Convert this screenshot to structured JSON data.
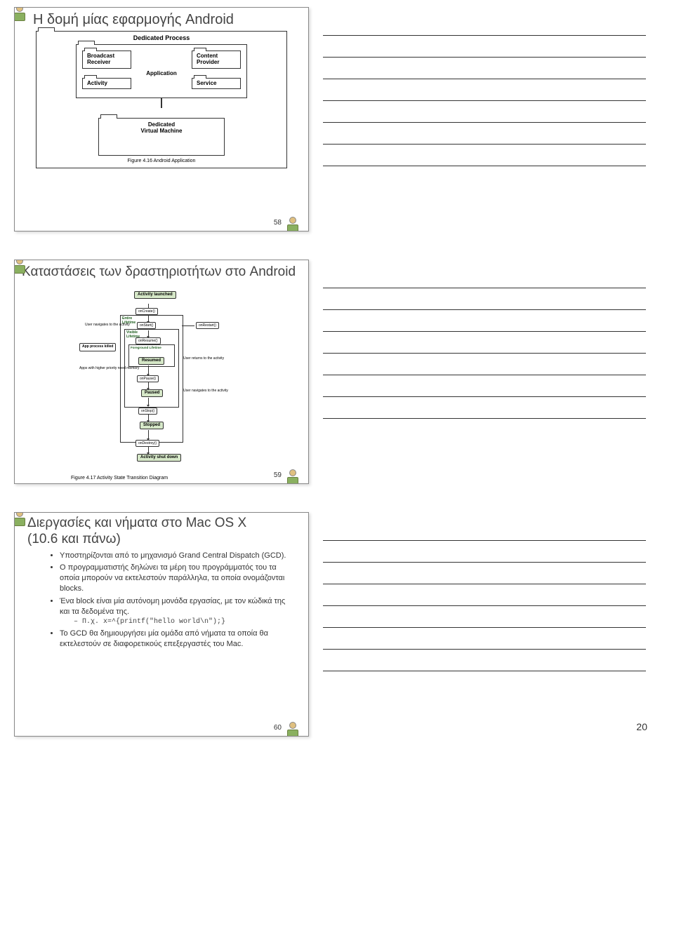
{
  "page_number": "20",
  "slide1": {
    "number": "58",
    "title": "Η δομή μίας εφαρμογής Android",
    "process_label": "Dedicated Process",
    "app_label": "Application",
    "boxes": {
      "broadcast": "Broadcast\nReceiver",
      "content": "Content\nProvider",
      "activity": "Activity",
      "service": "Service"
    },
    "vm_label": "Dedicated\nVirtual Machine",
    "caption": "Figure 4.16 Android Application"
  },
  "slide2": {
    "number": "59",
    "title": "Καταστάσεις των δραστηριοτήτων στο Android",
    "states": {
      "launched": "Activity\nlaunched",
      "resumed": "Resumed",
      "paused": "Paused",
      "stopped": "Stopped",
      "shutdown": "Activity\nshut down"
    },
    "calls": {
      "oncreate": "onCreate()",
      "onstart": "onStart()",
      "onresume": "onResume()",
      "onpause": "onPause()",
      "onstop": "onStop()",
      "ondestroy": "onDestroy()",
      "onrestart": "onRestart()"
    },
    "frames": {
      "entire": "Entire\nLifetime",
      "visible": "Visible\nLifetime",
      "foreground": "Foreground\nLifetime"
    },
    "side": {
      "killed": "App process\nkilled",
      "nav1": "User navigates\nto the activity",
      "highprio": "Apps with higher\npriority need memory",
      "returns": "User returns\nto the activity",
      "nav2": "User navigates\nto the activity"
    },
    "caption": "Figure 4.17 Activity State Transition Diagram"
  },
  "slide3": {
    "number": "60",
    "title": "Διεργασίες και νήματα στο Mac OS X (10.6 και πάνω)",
    "bullets": {
      "b1": "Υποστηρίζονται από το μηχανισμό Grand Central Dispatch (GCD).",
      "b2": "Ο προγραμματιστής δηλώνει τα μέρη του προγράμματός του τα οποία μπορούν να εκτελεστούν παράλληλα, τα οποία ονομάζονται blocks.",
      "b3": "Ένα block είναι μία αυτόνομη μονάδα εργασίας, με τον κώδικά της και τα δεδομένα της.",
      "b3sub": "Π.χ. x=^{printf(\"hello world\\n\");}",
      "b4": "Το GCD θα δημιουργήσει μία ομάδα από νήματα τα οποία θα εκτελεστούν σε διαφορετικούς επεξεργαστές του Mac."
    }
  }
}
